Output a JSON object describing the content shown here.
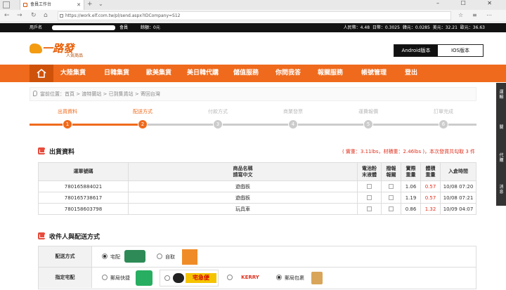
{
  "browser": {
    "tab_title": "會員工作台",
    "url": "https://work.elf.com.tw/pl/send.aspx?IDCompany=S12",
    "window_controls": "– ☐ ✕"
  },
  "infobar": {
    "user_prefix": "用戶名",
    "level": "會員",
    "balance_text": "餘額：0元",
    "rates": "人民幣：4.48  日幣：0.3025  韓元：0.0285  美元：32.21  歐元：36.63"
  },
  "logo": {
    "title": "一路發",
    "subtitle": "人気商品"
  },
  "apps": {
    "android": "Android版本",
    "ios": "IOS版本"
  },
  "nav": {
    "items": [
      "大陸集貨",
      "日韓集貨",
      "歐美集貨",
      "美日韓代購",
      "儲值服務",
      "你問我答",
      "報關服務",
      "帳號管理",
      "登出"
    ]
  },
  "breadcrumb": {
    "text": "當前位置：首頁 > 渡特蘭站 > 已到集貨站 > 寄回台灣"
  },
  "steps": [
    {
      "label": "出貨資料",
      "num": "1",
      "state": "done"
    },
    {
      "label": "配送方式",
      "num": "2",
      "state": "active"
    },
    {
      "label": "付款方式",
      "num": "3",
      "state": "pending"
    },
    {
      "label": "商業發票",
      "num": "4",
      "state": "pending"
    },
    {
      "label": "運費報價",
      "num": "5",
      "state": "pending"
    },
    {
      "label": "訂單完成",
      "num": "6",
      "state": "pending"
    }
  ],
  "shipment": {
    "title": "出貨資料",
    "weight_info": "( 實重：3.11lbs，材積重：2.46lbs )，本次發貨共勾取 3 件",
    "headers": [
      "運單號碼",
      "商品名稱\n請寫中文",
      "電池粉\n末液體",
      "撥報\n報關",
      "實際\n重量",
      "體積\n重量",
      "入倉時間"
    ],
    "rows": [
      {
        "tracking": "780165884021",
        "name": "遊戲板",
        "actual": "1.06",
        "volume": "0.57",
        "time": "10/08 07:20"
      },
      {
        "tracking": "780165738617",
        "name": "遊戲板",
        "actual": "1.19",
        "volume": "0.57",
        "time": "10/08 07:21"
      },
      {
        "tracking": "780158603798",
        "name": "玩具車",
        "actual": "0.86",
        "volume": "1.32",
        "time": "10/09 04:07"
      }
    ]
  },
  "delivery": {
    "title": "收件人與配送方式",
    "method_label": "配送方式",
    "home": "宅配",
    "pickup": "自取",
    "carrier_label": "指定宅配",
    "carriers": [
      "郵局快捷",
      "宅急便",
      "KERRY",
      "郵局包裹"
    ]
  },
  "sidebar": [
    "運輸",
    "關",
    "代購",
    "消息"
  ]
}
